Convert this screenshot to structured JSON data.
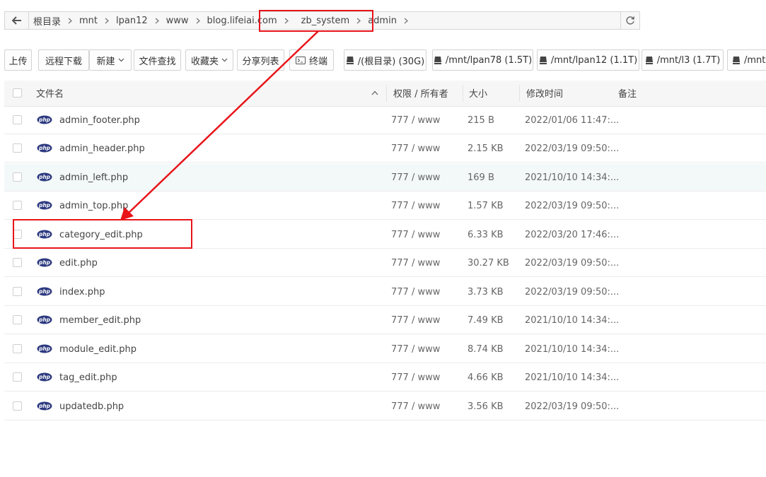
{
  "address_bar": {
    "crumbs": [
      {
        "label": "根目录"
      },
      {
        "label": "mnt"
      },
      {
        "label": "lpan12"
      },
      {
        "label": "www"
      },
      {
        "label": "blog.lifeiai.com"
      },
      {
        "label": "zb_system"
      },
      {
        "label": "admin"
      }
    ]
  },
  "toolbar": {
    "upload": "上传",
    "remote_download": "远程下载",
    "new": "新建",
    "file_search": "文件查找",
    "favorites": "收藏夹",
    "share_list": "分享列表",
    "terminal": "终端",
    "drives": [
      "/(根目录) (30G)",
      "/mnt/lpan78 (1.5T)",
      "/mnt/lpan12 (1.1T)",
      "/mnt/l3 (1.7T)",
      "/mnt"
    ]
  },
  "table": {
    "headers": {
      "name": "文件名",
      "perm": "权限 / 所有者",
      "size": "大小",
      "mtime": "修改时间",
      "note": "备注"
    },
    "rows": [
      {
        "name": "admin_footer.php",
        "perm": "777 / www",
        "size": "215 B",
        "mtime": "2022/01/06 11:47:..."
      },
      {
        "name": "admin_header.php",
        "perm": "777 / www",
        "size": "2.15 KB",
        "mtime": "2022/03/19 09:50:..."
      },
      {
        "name": "admin_left.php",
        "perm": "777 / www",
        "size": "169 B",
        "mtime": "2021/10/10 14:34:..."
      },
      {
        "name": "admin_top.php",
        "perm": "777 / www",
        "size": "1.57 KB",
        "mtime": "2022/03/19 09:50:..."
      },
      {
        "name": "category_edit.php",
        "perm": "777 / www",
        "size": "6.33 KB",
        "mtime": "2022/03/20 17:46:..."
      },
      {
        "name": "edit.php",
        "perm": "777 / www",
        "size": "30.27 KB",
        "mtime": "2022/03/19 09:50:..."
      },
      {
        "name": "index.php",
        "perm": "777 / www",
        "size": "3.73 KB",
        "mtime": "2022/03/19 09:50:..."
      },
      {
        "name": "member_edit.php",
        "perm": "777 / www",
        "size": "7.49 KB",
        "mtime": "2021/10/10 14:34:..."
      },
      {
        "name": "module_edit.php",
        "perm": "777 / www",
        "size": "8.74 KB",
        "mtime": "2021/10/10 14:34:..."
      },
      {
        "name": "tag_edit.php",
        "perm": "777 / www",
        "size": "4.66 KB",
        "mtime": "2021/10/10 14:34:..."
      },
      {
        "name": "updatedb.php",
        "perm": "777 / www",
        "size": "3.56 KB",
        "mtime": "2022/03/19 09:50:..."
      }
    ]
  },
  "icons": {
    "back": "arrow-left-icon",
    "refresh": "refresh-icon",
    "drive": "hard-drive-icon",
    "terminal": "terminal-icon",
    "file": "php-file-icon",
    "sort": "sort-up-icon"
  },
  "colors": {
    "annotation": "#e8141a",
    "php_badge": "#2d3a80",
    "row_hover": "#f3f8f8"
  }
}
